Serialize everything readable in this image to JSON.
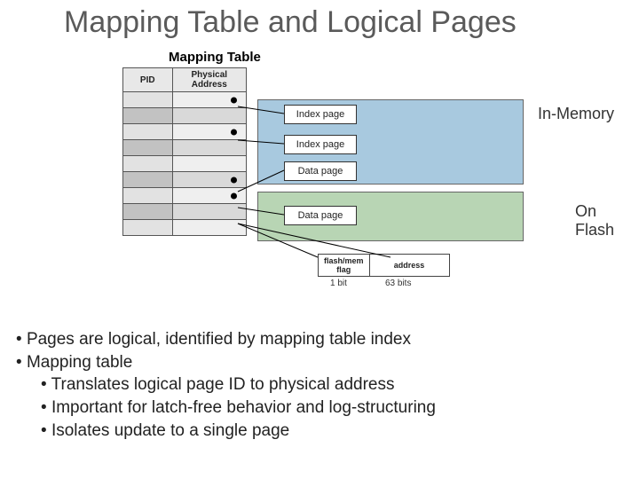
{
  "title": "Mapping Table and Logical Pages",
  "subtitle": "Mapping Table",
  "table_headers": {
    "pid": "PID",
    "phys": "Physical\nAddress"
  },
  "region_labels": {
    "memory": "In-Memory",
    "flash": "On\nFlash"
  },
  "pages": {
    "index1": "Index page",
    "index2": "Index page",
    "data1": "Data page",
    "data2": "Data page"
  },
  "mini": {
    "flag": "flash/mem\nflag",
    "addr": "address",
    "flag_bits": "1 bit",
    "addr_bits": "63 bits"
  },
  "bullets": {
    "b1": "Pages are logical, identified by mapping table index",
    "b2": "Mapping table",
    "b2a": "Translates logical page ID to physical address",
    "b2b": "Important for latch-free behavior and log-structuring",
    "b2c": "Isolates update to a single page"
  }
}
